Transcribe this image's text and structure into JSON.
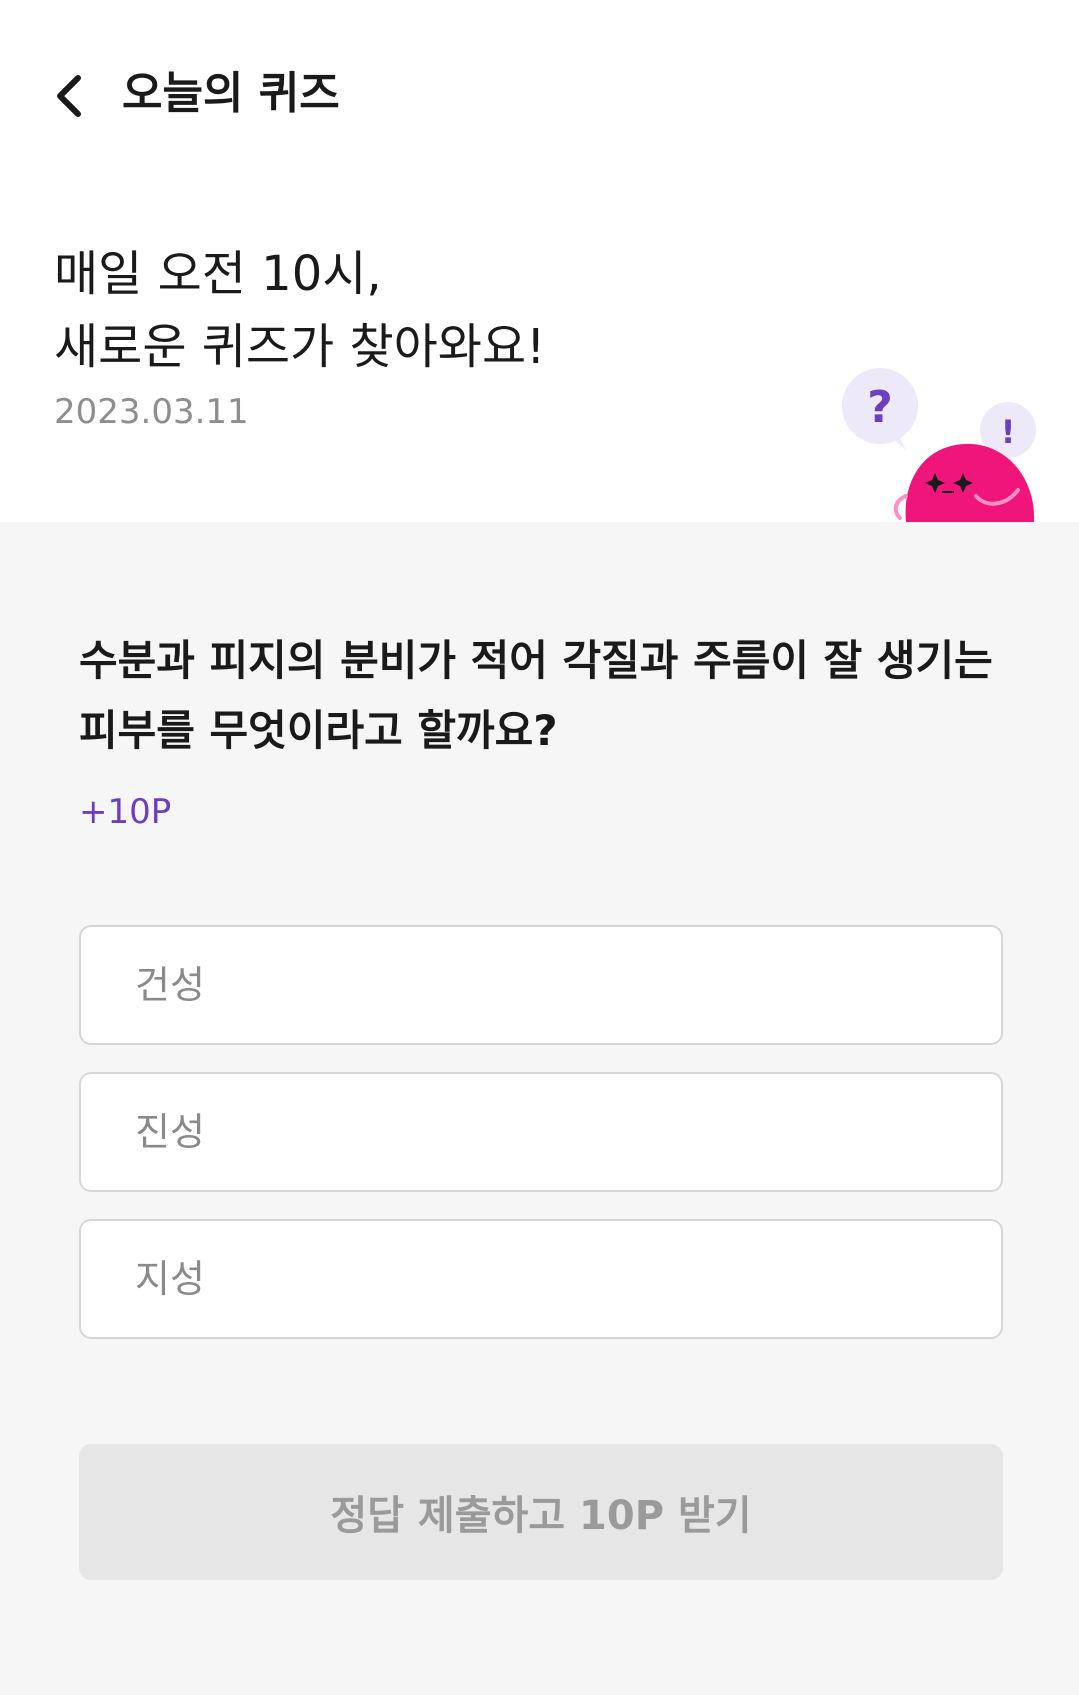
{
  "header": {
    "title": "오늘의 퀴즈",
    "back_icon": "chevron-left-icon"
  },
  "intro": {
    "line1": "매일 오전 10시,",
    "line2": "새로운 퀴즈가 찾아와요!",
    "date": "2023.03.11",
    "mascot_question_mark": "?",
    "mascot_exclamation": "!"
  },
  "quiz": {
    "question": "수분과 피지의 분비가 적어 각질과 주름이 잘 생기는 피부를 무엇이라고 할까요?",
    "points": "+10P",
    "options": [
      {
        "label": "건성"
      },
      {
        "label": "진성"
      },
      {
        "label": "지성"
      }
    ],
    "submit_label": "정답 제출하고 10P 받기"
  },
  "colors": {
    "accent_purple": "#6b3fbf",
    "mascot_pink": "#f0157a",
    "bubble_bg": "#ede9f8",
    "section_bg": "#f6f6f6",
    "button_disabled_bg": "#e6e6e6"
  }
}
